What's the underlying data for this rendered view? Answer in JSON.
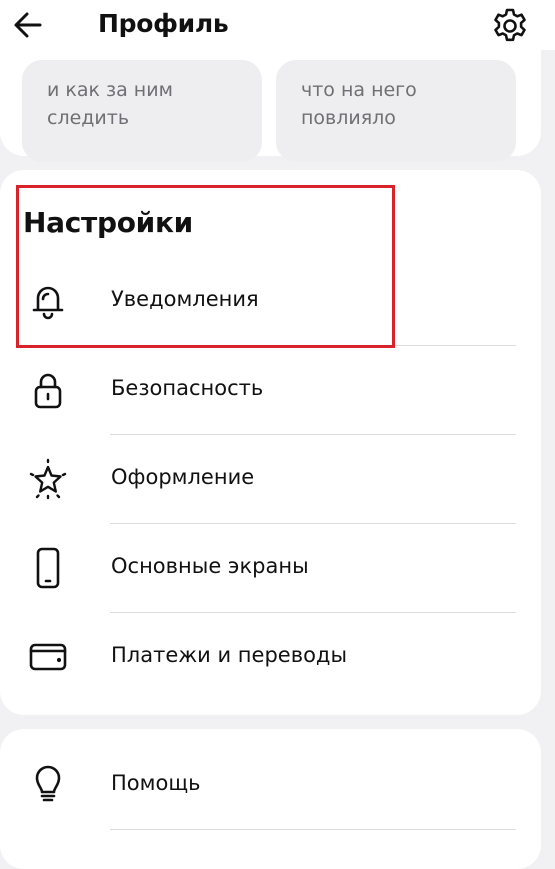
{
  "header": {
    "title": "Профиль",
    "back_icon": "arrow-left-icon",
    "settings_icon": "gear-icon"
  },
  "tiles": [
    {
      "text": "и как за ним\nследить"
    },
    {
      "text": "что на него\nповлияло"
    }
  ],
  "settings": {
    "title": "Настройки",
    "highlight_color": "#d8232a",
    "items": [
      {
        "label": "Уведомления",
        "icon": "bell-icon"
      },
      {
        "label": "Безопасность",
        "icon": "lock-icon"
      },
      {
        "label": "Оформление",
        "icon": "sparkle-star-icon"
      },
      {
        "label": "Основные экраны",
        "icon": "phone-icon"
      },
      {
        "label": "Платежи и переводы",
        "icon": "wallet-icon"
      }
    ]
  },
  "help": {
    "items": [
      {
        "label": "Помощь",
        "icon": "lightbulb-icon"
      }
    ]
  }
}
